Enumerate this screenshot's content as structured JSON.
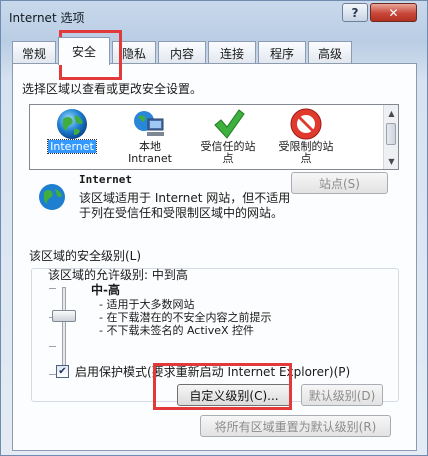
{
  "window": {
    "title": "Internet 选项",
    "help_label": "?",
    "close_label": "✕"
  },
  "tabs": [
    {
      "label": "常规"
    },
    {
      "label": "安全"
    },
    {
      "label": "隐私"
    },
    {
      "label": "内容"
    },
    {
      "label": "连接"
    },
    {
      "label": "程序"
    },
    {
      "label": "高级"
    }
  ],
  "active_tab": "安全",
  "zone_prompt": "选择区域以查看或更改安全设置。",
  "zones": [
    {
      "label": "Internet",
      "icon": "globe-icon"
    },
    {
      "label": "本地\nIntranet",
      "icon": "computer-globe-icon"
    },
    {
      "label": "受信任的站\n点",
      "icon": "checkmark-icon"
    },
    {
      "label": "受限制的站\n点",
      "icon": "no-entry-icon"
    }
  ],
  "selected_zone": {
    "title": "Internet",
    "description": "该区域适用于 Internet 网站，但不适用于列在受信任和受限制区域中的网站。"
  },
  "sites_button": "站点(S)",
  "security_level": {
    "group_label": "该区域的安全级别(L)",
    "allowed_levels": "该区域的允许级别: 中到高",
    "level_name": "中-高",
    "bullets": [
      "- 适用于大多数网站",
      "- 在下载潜在的不安全内容之前提示",
      "- 不下载未签名的 ActiveX 控件"
    ],
    "slider_position_fraction": 0.33
  },
  "protected_mode": {
    "label": "启用保护模式(要求重新启动 Internet Explorer)(P)",
    "checked": true
  },
  "buttons": {
    "custom_level": "自定义级别(C)...",
    "default_level": "默认级别(D)",
    "reset_all": "将所有区域重置为默认级别(R)"
  },
  "colors": {
    "highlight": "#e23a3a",
    "selection": "#3399ff"
  }
}
